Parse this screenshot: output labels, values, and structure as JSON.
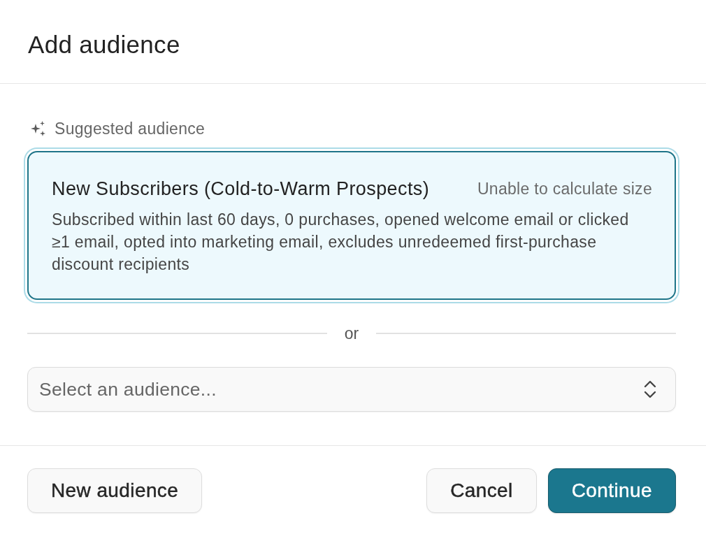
{
  "dialog": {
    "title": "Add audience"
  },
  "suggestion": {
    "label": "Suggested audience",
    "card": {
      "name": "New Subscribers (Cold-to-Warm Prospects)",
      "size_note": "Unable to calculate size",
      "description": "Subscribed within last 60 days, 0 purchases, opened welcome email or clicked ≥1 email, opted into marketing email, excludes unredeemed first-purchase discount recipients",
      "selected": true
    }
  },
  "divider": {
    "text": "or"
  },
  "audience_select": {
    "placeholder": "Select an audience..."
  },
  "footer": {
    "left_buttons": [
      {
        "label": "New audience",
        "kind": "secondary"
      }
    ],
    "right_buttons": [
      {
        "label": "Cancel",
        "kind": "secondary"
      },
      {
        "label": "Continue",
        "kind": "primary"
      }
    ]
  }
}
